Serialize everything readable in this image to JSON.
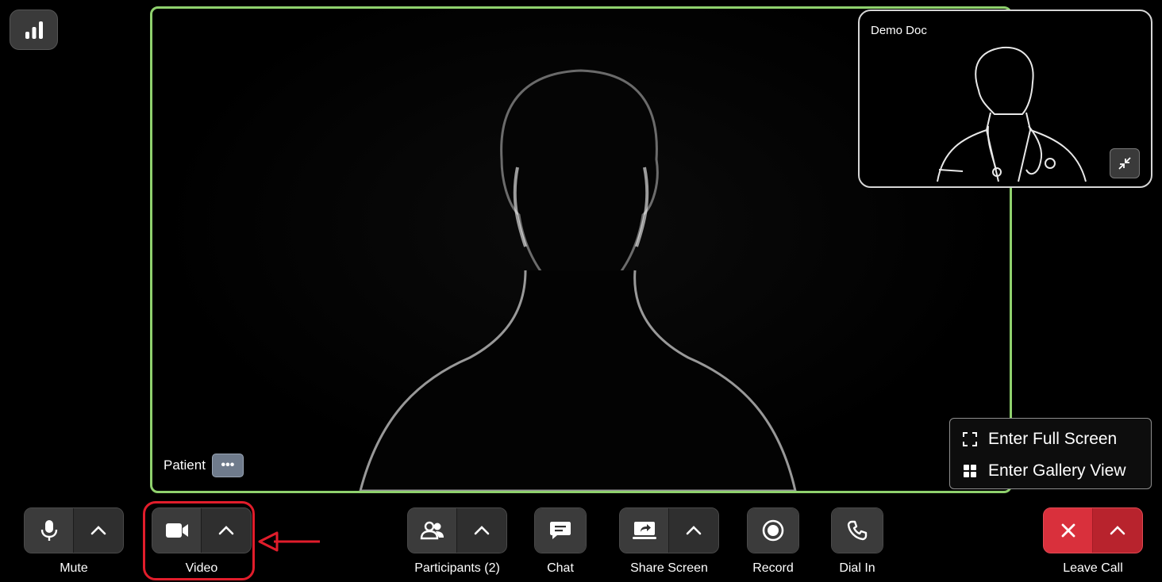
{
  "main_tile": {
    "name": "Patient",
    "more_label": "•••"
  },
  "pip_tile": {
    "name": "Demo Doc"
  },
  "view_menu": {
    "items": [
      {
        "label": "Enter Full Screen",
        "icon": "fullscreen-icon"
      },
      {
        "label": "Enter Gallery View",
        "icon": "gallery-icon"
      }
    ]
  },
  "toolbar": {
    "mute": {
      "label": "Mute",
      "icon": "microphone-icon"
    },
    "video": {
      "label": "Video",
      "icon": "video-camera-icon"
    },
    "participants": {
      "label": "Participants (2)",
      "icon": "participants-icon"
    },
    "chat": {
      "label": "Chat",
      "icon": "chat-icon"
    },
    "share_screen": {
      "label": "Share Screen",
      "icon": "share-screen-icon"
    },
    "record": {
      "label": "Record",
      "icon": "record-icon"
    },
    "dial_in": {
      "label": "Dial In",
      "icon": "phone-icon"
    },
    "leave_call": {
      "label": "Leave Call",
      "icon": "close-icon"
    }
  },
  "colors": {
    "active_speaker_border": "#8fd16d",
    "leave_call": "#d22b36",
    "annotation": "#e11d2b"
  }
}
